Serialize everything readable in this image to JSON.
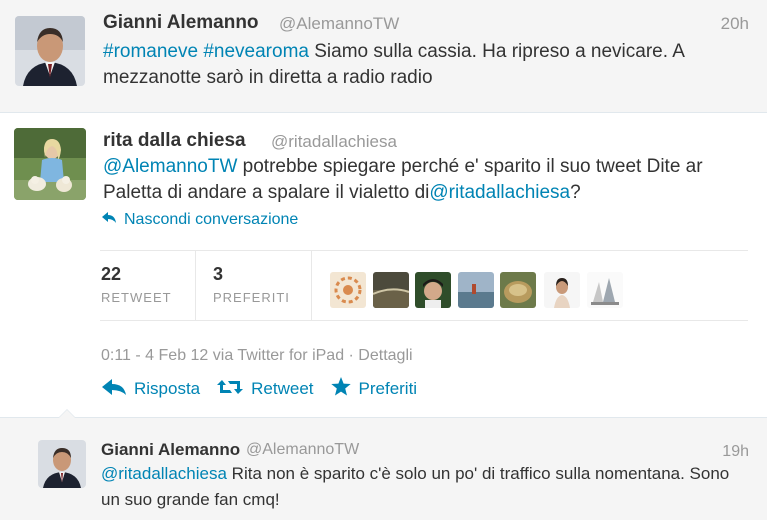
{
  "tweets": [
    {
      "name": "Gianni Alemanno",
      "handle": "@AlemannoTW",
      "time": "20h",
      "text_parts": [
        "#romaneve",
        " ",
        "#nevearoma",
        " Siamo sulla cassia. Ha ripreso a nevicare. A mezzanotte sarò in diretta a radio radio"
      ]
    },
    {
      "name": "rita dalla chiesa",
      "handle": "@ritadallachiesa",
      "text_parts": [
        "@AlemannoTW",
        " potrebbe spiegare perché e' sparito il suo tweet Dite ar Paletta di andare a spalare il vialetto di",
        "@ritadallachiesa",
        "?"
      ],
      "hide_conversation": "Nascondi conversazione",
      "stats": {
        "retweet_count": "22",
        "retweet_label": "RETWEET",
        "favorites_count": "3",
        "favorites_label": "PREFERITI"
      },
      "meta": "0:11 - 4 Feb 12 via Twitter for iPad · Dettagli",
      "actions": {
        "reply": "Risposta",
        "retweet": "Retweet",
        "favorite": "Preferiti"
      }
    },
    {
      "name": "Gianni Alemanno",
      "handle": "@AlemannoTW",
      "time": "19h",
      "text_parts": [
        "@ritadallachiesa",
        " Rita non è sparito c'è solo un po' di traffico sulla nomentana. Sono un suo grande fan cmq!"
      ]
    }
  ],
  "colors": {
    "link": "#0084b4",
    "muted": "#999999",
    "text": "#333333"
  }
}
